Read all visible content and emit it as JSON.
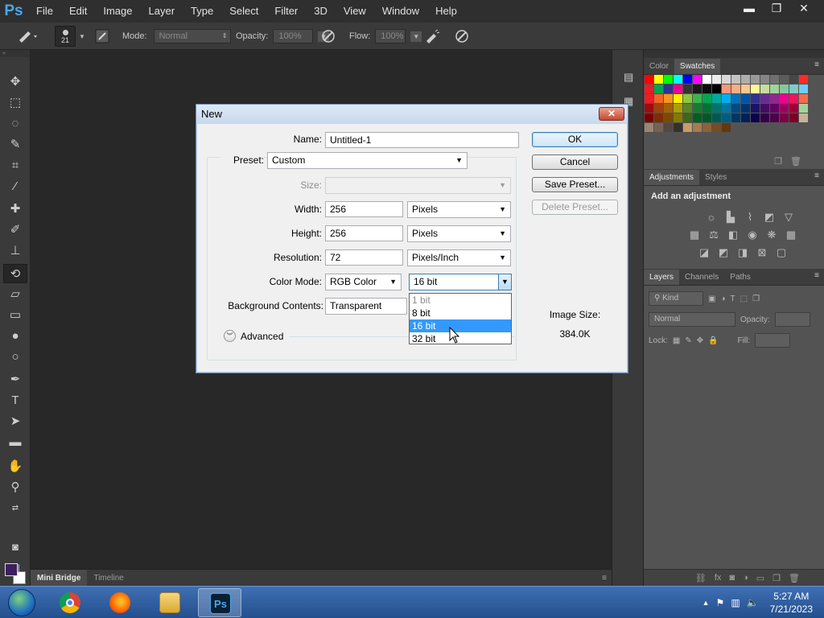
{
  "app": {
    "logo": "Ps"
  },
  "menu": [
    "File",
    "Edit",
    "Image",
    "Layer",
    "Type",
    "Select",
    "Filter",
    "3D",
    "View",
    "Window",
    "Help"
  ],
  "window_controls": {
    "minimize": "▬",
    "restore": "❐",
    "close": "✕"
  },
  "options_bar": {
    "brush_size": "21",
    "mode_label": "Mode:",
    "mode_value": "Normal",
    "opacity_label": "Opacity:",
    "opacity_value": "100%",
    "flow_label": "Flow:",
    "flow_value": "100%"
  },
  "toolbar": {
    "strip": "»",
    "tools": [
      "move-icon",
      "marquee-icon",
      "lasso-icon",
      "quick-select-icon",
      "crop-icon",
      "eyedropper-icon",
      "healing-brush-icon",
      "brush-icon",
      "clone-stamp-icon",
      "history-brush-icon",
      "eraser-icon",
      "gradient-icon",
      "blur-icon",
      "dodge-icon",
      "pen-icon",
      "type-icon",
      "path-select-icon",
      "shape-icon",
      "hand-icon",
      "zoom-icon"
    ],
    "foreground_color": "#3b1f5e",
    "background_color": "#ffffff"
  },
  "mini_bridge": {
    "tabs": [
      "Mini Bridge",
      "Timeline"
    ]
  },
  "panels": {
    "color_swatches": {
      "tabs": [
        "Color",
        "Swatches"
      ]
    },
    "adjustments": {
      "tabs": [
        "Adjustments",
        "Styles"
      ],
      "title": "Add an adjustment"
    },
    "layers": {
      "tabs": [
        "Layers",
        "Channels",
        "Paths"
      ],
      "kind_label": "Kind",
      "blend_value": "Normal",
      "opacity_label": "Opacity:",
      "lock_label": "Lock:",
      "fill_label": "Fill:"
    }
  },
  "dialog": {
    "title": "New",
    "close": "✕",
    "name_label": "Name:",
    "name_value": "Untitled-1",
    "preset_label": "Preset:",
    "preset_value": "Custom",
    "size_label": "Size:",
    "width_label": "Width:",
    "width_value": "256",
    "width_unit": "Pixels",
    "height_label": "Height:",
    "height_value": "256",
    "height_unit": "Pixels",
    "resolution_label": "Resolution:",
    "resolution_value": "72",
    "resolution_unit": "Pixels/Inch",
    "color_mode_label": "Color Mode:",
    "color_mode_value": "RGB Color",
    "bit_depth_value": "16 bit",
    "bit_depth_options": [
      "1 bit",
      "8 bit",
      "16 bit",
      "32 bit"
    ],
    "background_label": "Background Contents:",
    "background_value": "Transparent",
    "advanced_label": "Advanced",
    "ok": "OK",
    "cancel": "Cancel",
    "save_preset": "Save Preset...",
    "delete_preset": "Delete Preset...",
    "image_size_label": "Image Size:",
    "image_size_value": "384.0K"
  },
  "taskbar": {
    "apps": [
      "chrome-icon",
      "firefox-icon",
      "file-explorer-icon",
      "photoshop-icon"
    ],
    "ps_label": "Ps",
    "time": "5:27 AM",
    "date": "7/21/2023"
  }
}
